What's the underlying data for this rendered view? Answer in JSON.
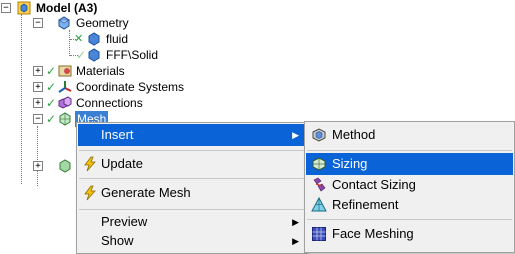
{
  "tree": {
    "root": "Model (A3)",
    "geometry": "Geometry",
    "fluid": "fluid",
    "solid": "FFF\\Solid",
    "materials": "Materials",
    "coordinate_systems": "Coordinate Systems",
    "connections": "Connections",
    "mesh": "Mesh"
  },
  "context_menu": {
    "insert": "Insert",
    "update": "Update",
    "generate_mesh": "Generate Mesh",
    "preview": "Preview",
    "show": "Show"
  },
  "submenu": {
    "method": "Method",
    "sizing": "Sizing",
    "contact_sizing": "Contact Sizing",
    "refinement": "Refinement",
    "face_meshing": "Face Meshing"
  },
  "colors": {
    "highlight": "#0a64d8",
    "selected_tree_item": "#3b7fd4",
    "check": "#2ea043",
    "menu_background": "#f0f0f0"
  }
}
